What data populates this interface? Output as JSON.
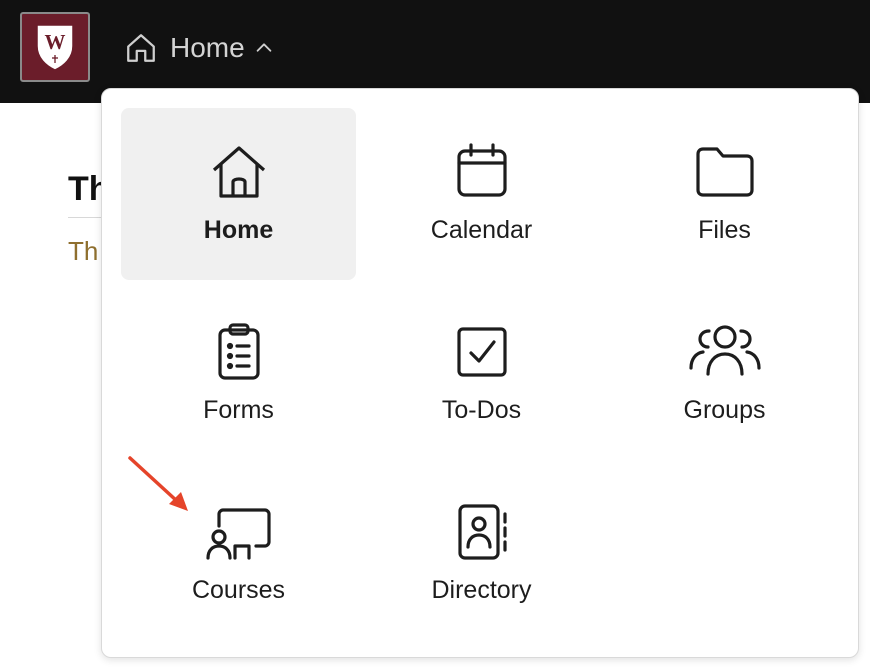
{
  "header": {
    "nav_label": "Home"
  },
  "background_page": {
    "heading_fragment": "Th",
    "subtext_fragment": "Th"
  },
  "menu": {
    "items": [
      {
        "label": "Home",
        "icon": "home-icon",
        "active": true
      },
      {
        "label": "Calendar",
        "icon": "calendar-icon",
        "active": false
      },
      {
        "label": "Files",
        "icon": "folder-icon",
        "active": false
      },
      {
        "label": "Forms",
        "icon": "clipboard-list-icon",
        "active": false
      },
      {
        "label": "To-Dos",
        "icon": "checkbox-icon",
        "active": false
      },
      {
        "label": "Groups",
        "icon": "users-icon",
        "active": false
      },
      {
        "label": "Courses",
        "icon": "course-presentation-icon",
        "active": false
      },
      {
        "label": "Directory",
        "icon": "contact-book-icon",
        "active": false
      }
    ]
  },
  "colors": {
    "topbar": "#111111",
    "logo_bg": "#6b1d2a",
    "active_tile": "#f0f0f0",
    "annotation_arrow": "#e5442a",
    "subtext": "#8f6f2e"
  }
}
